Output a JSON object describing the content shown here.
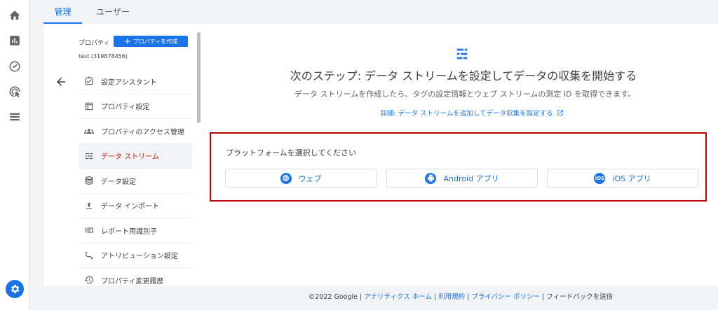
{
  "rail": {
    "icons": [
      "home-icon",
      "reports-icon",
      "explore-icon",
      "advertising-icon",
      "configure-icon"
    ],
    "settings_icon": "gear-icon"
  },
  "tabs": [
    {
      "label": "管理",
      "active": true
    },
    {
      "label": "ユーザー",
      "active": false
    }
  ],
  "nav": {
    "property_label": "プロパティ",
    "create_button": "プロパティを作成",
    "property_id": "test (319878456)",
    "items": [
      {
        "label": "設定アシスタント",
        "icon": "checklist-icon"
      },
      {
        "label": "プロパティ設定",
        "icon": "layout-icon"
      },
      {
        "label": "プロパティのアクセス管理",
        "icon": "people-icon"
      },
      {
        "label": "データ ストリーム",
        "icon": "data-stream-icon",
        "active": true
      },
      {
        "label": "データ設定",
        "icon": "database-icon"
      },
      {
        "label": "データ インポート",
        "icon": "upload-icon"
      },
      {
        "label": "レポート用識別子",
        "icon": "identity-icon"
      },
      {
        "label": "アトリビューション設定",
        "icon": "attribution-icon"
      },
      {
        "label": "プロパティ変更履歴",
        "icon": "history-icon"
      }
    ]
  },
  "main": {
    "headline": "次のステップ: データ ストリームを設定してデータの収集を開始する",
    "subline": "データ ストリームを作成したら、タグの設定情報とウェブ ストリームの測定 ID を取得できます。",
    "detail_link": "詳細: データ ストリームを追加してデータ収集を設定する",
    "platform_title": "プラットフォームを選択してください",
    "platforms": [
      {
        "label": "ウェブ",
        "icon": "globe-icon"
      },
      {
        "label": "Android アプリ",
        "icon": "android-icon"
      },
      {
        "label": "iOS アプリ",
        "icon": "ios-icon",
        "icon_text": "iOS"
      }
    ],
    "accent_color": "#1a73e8",
    "highlight_color": "#c00000"
  },
  "footer": {
    "copyright": "©2022 Google",
    "links": [
      "アナリティクス ホーム",
      "利用規約",
      "プライバシー ポリシー"
    ],
    "feedback": "フィードバックを送信"
  }
}
